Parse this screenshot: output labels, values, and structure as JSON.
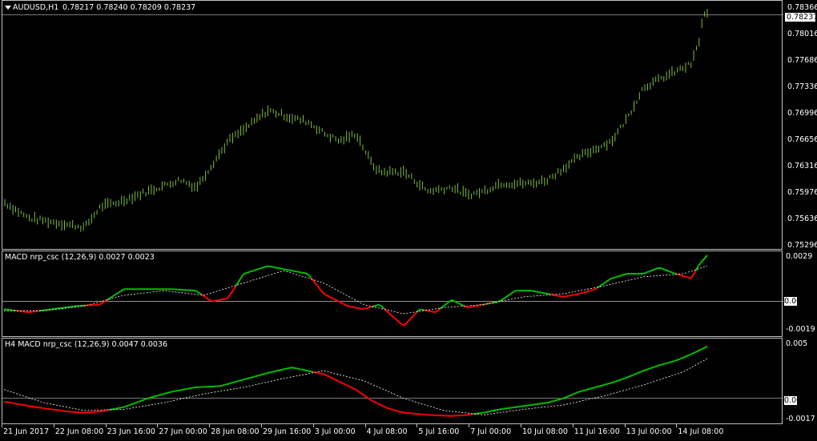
{
  "main_pane": {
    "symbol": "AUDUSD,H1",
    "ohlc": "0.78217 0.78240 0.78209 0.78237",
    "current_price": "0.78237",
    "price_ticks": [
      "0.78366",
      "0.78016",
      "0.77686",
      "0.77336",
      "0.76996",
      "0.76656",
      "0.76316",
      "0.75976",
      "0.75636",
      "0.75296"
    ],
    "bar_color": "#7fbf3f"
  },
  "macd_pane": {
    "title": "MACD nrp_csc (12,26,9) 0.0027 0.0023",
    "ticks": [
      "0.0029",
      "0.00",
      "-0.0019"
    ],
    "zero_label": "0.00",
    "up_color": "#00c000",
    "down_color": "#ff0000"
  },
  "h4_pane": {
    "title": "H4 MACD nrp_csc (12,26,9) 0.0047 0.0036",
    "ticks": [
      "0.005",
      "0.00",
      "-0.0017"
    ],
    "zero_label": "0.00"
  },
  "time_axis": [
    "21 Jun 2017",
    "22 Jun 08:00",
    "23 Jun 16:00",
    "27 Jun 00:00",
    "28 Jun 08:00",
    "29 Jun 16:00",
    "3 Jul 00:00",
    "4 Jul 08:00",
    "5 Jul 16:00",
    "7 Jul 00:00",
    "10 Jul 08:00",
    "11 Jul 16:00",
    "13 Jul 00:00",
    "14 Jul 08:00"
  ],
  "chart_data": [
    {
      "type": "bar",
      "title": "AUDUSD,H1",
      "ylim": [
        0.752,
        0.784
      ],
      "close_profile_x": [
        0,
        0.03,
        0.06,
        0.1,
        0.12,
        0.14,
        0.18,
        0.22,
        0.24,
        0.28,
        0.3,
        0.33,
        0.36,
        0.38,
        0.4,
        0.42,
        0.44,
        0.46,
        0.47,
        0.5,
        0.53,
        0.56,
        0.58,
        0.6,
        0.62,
        0.64,
        0.66,
        0.68,
        0.7,
        0.72,
        0.74,
        0.76,
        0.78,
        0.8,
        0.82,
        0.84,
        0.86,
        0.87,
        0.875,
        0.88
      ],
      "close_profile_y": [
        0.758,
        0.756,
        0.7555,
        0.7548,
        0.7575,
        0.758,
        0.7595,
        0.761,
        0.76,
        0.766,
        0.7675,
        0.77,
        0.769,
        0.7685,
        0.767,
        0.766,
        0.767,
        0.763,
        0.762,
        0.762,
        0.7595,
        0.76,
        0.759,
        0.7595,
        0.7605,
        0.7605,
        0.7605,
        0.761,
        0.7625,
        0.764,
        0.765,
        0.766,
        0.769,
        0.773,
        0.774,
        0.775,
        0.776,
        0.779,
        0.7825,
        0.7824
      ]
    },
    {
      "type": "line",
      "title": "MACD nrp_csc (12,26,9)",
      "ylim": [
        -0.0022,
        0.0031
      ],
      "series": [
        {
          "name": "MACD",
          "x": [
            0,
            0.03,
            0.06,
            0.09,
            0.12,
            0.15,
            0.18,
            0.21,
            0.24,
            0.26,
            0.28,
            0.3,
            0.33,
            0.36,
            0.38,
            0.4,
            0.43,
            0.45,
            0.47,
            0.5,
            0.52,
            0.54,
            0.56,
            0.58,
            0.6,
            0.62,
            0.64,
            0.66,
            0.68,
            0.7,
            0.72,
            0.74,
            0.76,
            0.78,
            0.8,
            0.82,
            0.84,
            0.86,
            0.87,
            0.88
          ],
          "values": [
            -0.0005,
            -0.0007,
            -0.0005,
            -0.0003,
            -0.0002,
            0.0008,
            0.0008,
            0.0008,
            0.0007,
            0.0,
            0.0002,
            0.0018,
            0.0023,
            0.002,
            0.0018,
            0.0005,
            -0.0003,
            -0.0005,
            -0.0002,
            -0.0016,
            -0.0005,
            -0.0007,
            0.0001,
            -0.0004,
            -0.0002,
            0.0,
            0.0007,
            0.0007,
            0.0005,
            0.0003,
            0.0005,
            0.0008,
            0.0015,
            0.0018,
            0.0018,
            0.0022,
            0.0018,
            0.0015,
            0.0024,
            0.003
          ]
        },
        {
          "name": "Signal",
          "x": [
            0,
            0.05,
            0.1,
            0.15,
            0.2,
            0.25,
            0.3,
            0.35,
            0.4,
            0.45,
            0.5,
            0.55,
            0.6,
            0.65,
            0.7,
            0.75,
            0.8,
            0.85,
            0.88
          ],
          "values": [
            -0.0006,
            -0.0006,
            -0.0003,
            0.0004,
            0.0007,
            0.0004,
            0.0012,
            0.002,
            0.0012,
            -0.0002,
            -0.0008,
            -0.0004,
            -0.0002,
            0.0003,
            0.0005,
            0.001,
            0.0016,
            0.0018,
            0.0023
          ]
        }
      ]
    },
    {
      "type": "line",
      "title": "H4 MACD nrp_csc (12,26,9)",
      "ylim": [
        -0.0022,
        0.0052
      ],
      "series": [
        {
          "name": "MACD",
          "x": [
            0,
            0.04,
            0.08,
            0.1,
            0.12,
            0.15,
            0.18,
            0.21,
            0.24,
            0.27,
            0.3,
            0.33,
            0.36,
            0.38,
            0.4,
            0.42,
            0.44,
            0.46,
            0.48,
            0.5,
            0.53,
            0.56,
            0.58,
            0.6,
            0.62,
            0.65,
            0.68,
            0.7,
            0.72,
            0.74,
            0.76,
            0.78,
            0.8,
            0.82,
            0.84,
            0.86,
            0.88
          ],
          "values": [
            -0.0003,
            -0.0008,
            -0.0012,
            -0.0013,
            -0.0012,
            -0.0008,
            0.0,
            0.0006,
            0.001,
            0.0011,
            0.0017,
            0.0023,
            0.0028,
            0.0025,
            0.0022,
            0.0015,
            0.0008,
            -0.0002,
            -0.0009,
            -0.0013,
            -0.0015,
            -0.0016,
            -0.0015,
            -0.0013,
            -0.001,
            -0.0007,
            -0.0004,
            0.0,
            0.0006,
            0.001,
            0.0014,
            0.0019,
            0.0025,
            0.003,
            0.0034,
            0.004,
            0.0047
          ]
        },
        {
          "name": "Signal",
          "x": [
            0,
            0.05,
            0.1,
            0.15,
            0.2,
            0.25,
            0.3,
            0.35,
            0.4,
            0.45,
            0.5,
            0.55,
            0.6,
            0.65,
            0.7,
            0.75,
            0.8,
            0.85,
            0.88
          ],
          "values": [
            0.0008,
            -0.0004,
            -0.0011,
            -0.001,
            -0.0004,
            0.0004,
            0.001,
            0.0018,
            0.0025,
            0.0016,
            0.0,
            -0.0011,
            -0.0015,
            -0.001,
            -0.0006,
            0.0002,
            0.0012,
            0.0024,
            0.0036
          ]
        }
      ]
    }
  ]
}
